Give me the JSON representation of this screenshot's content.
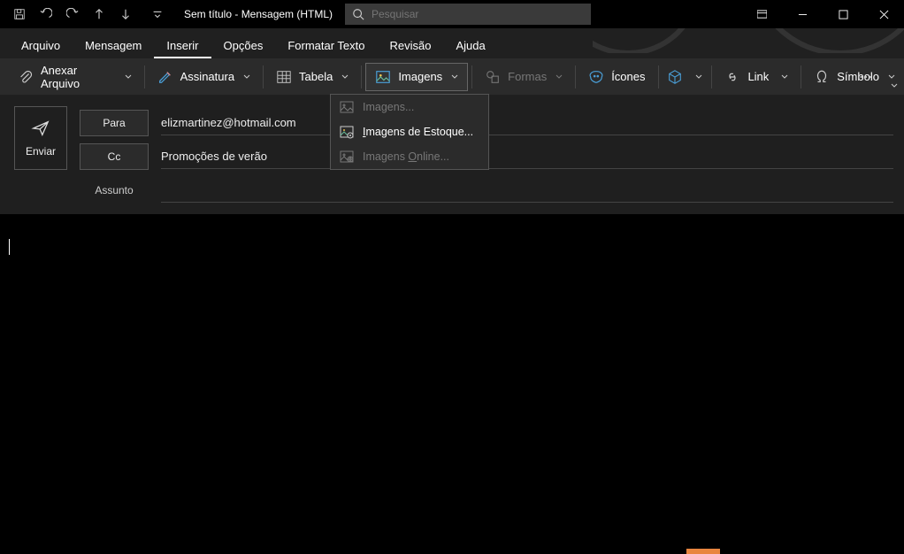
{
  "title": "Sem título  -  Mensagem (HTML)",
  "search": {
    "placeholder": "Pesquisar"
  },
  "menu": {
    "arquivo": "Arquivo",
    "mensagem": "Mensagem",
    "inserir": "Inserir",
    "opcoes": "Opções",
    "formatar": "Formatar Texto",
    "revisao": "Revisão",
    "ajuda": "Ajuda"
  },
  "ribbon": {
    "anexar": "Anexar Arquivo",
    "assinatura": "Assinatura",
    "tabela": "Tabela",
    "imagens": "Imagens",
    "formas": "Formas",
    "icones": "Ícones",
    "link": "Link",
    "simbolo": "Símbolo"
  },
  "dropdown": {
    "imagens": "Imagens...",
    "estoque_prefix": "I",
    "estoque_rest": "magens de Estoque...",
    "online_prefix": "Imagens ",
    "online_u": "O",
    "online_rest": "nline..."
  },
  "compose": {
    "enviar": "Enviar",
    "para": "Para",
    "cc": "Cc",
    "assunto": "Assunto",
    "to_value": "elizmartinez@hotmail.com",
    "cc_value": "Promoções de verão",
    "subject_value": ""
  }
}
